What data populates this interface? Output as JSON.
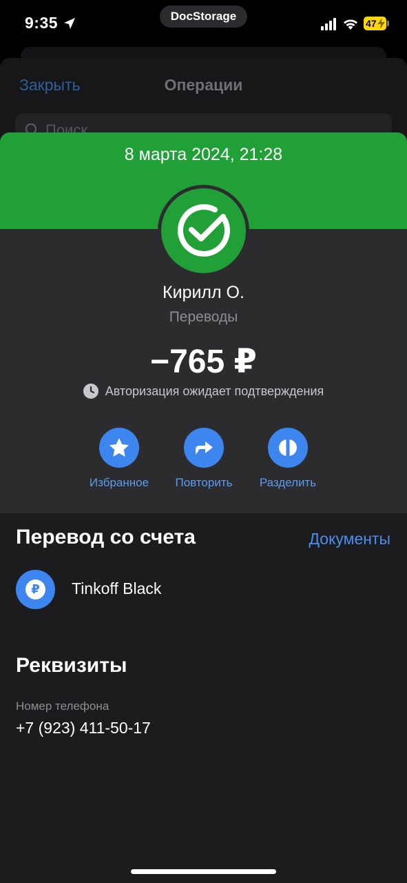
{
  "status_bar": {
    "time": "9:35",
    "app_pill": "DocStorage",
    "battery": "47"
  },
  "background": {
    "close_label": "Закрыть",
    "title": "Операции",
    "search_placeholder": "Поиск"
  },
  "operation": {
    "datetime": "8 марта 2024, 21:28",
    "recipient": "Кирилл О.",
    "category": "Переводы",
    "amount": "−765 ₽",
    "status": "Авторизация ожидает подтверждения"
  },
  "actions": {
    "favorite_label": "Избранное",
    "repeat_label": "Повторить",
    "split_label": "Разделить"
  },
  "transfer": {
    "section_title": "Перевод со счета",
    "documents_link": "Документы",
    "account_name": "Tinkoff Black",
    "account_icon_glyph": "₽"
  },
  "details": {
    "section_title": "Реквизиты",
    "phone_label": "Номер телефона",
    "phone_value": "+7 (923) 411-50-17"
  },
  "colors": {
    "brand_green": "#21a038",
    "accent_blue": "#3d86f0",
    "link_blue": "#4a8ff0",
    "background": "#1c1c1e",
    "top_panel": "#2c2c2e"
  },
  "icons": {
    "location": "location-arrow-icon",
    "signal": "cellular-signal-icon",
    "wifi": "wifi-icon",
    "battery": "battery-icon",
    "logo": "sber-checkmark-icon",
    "clock": "clock-icon",
    "favorite": "star-icon",
    "repeat": "repeat-arrow-icon",
    "split": "split-icon",
    "account": "ruble-icon",
    "search": "search-icon"
  }
}
